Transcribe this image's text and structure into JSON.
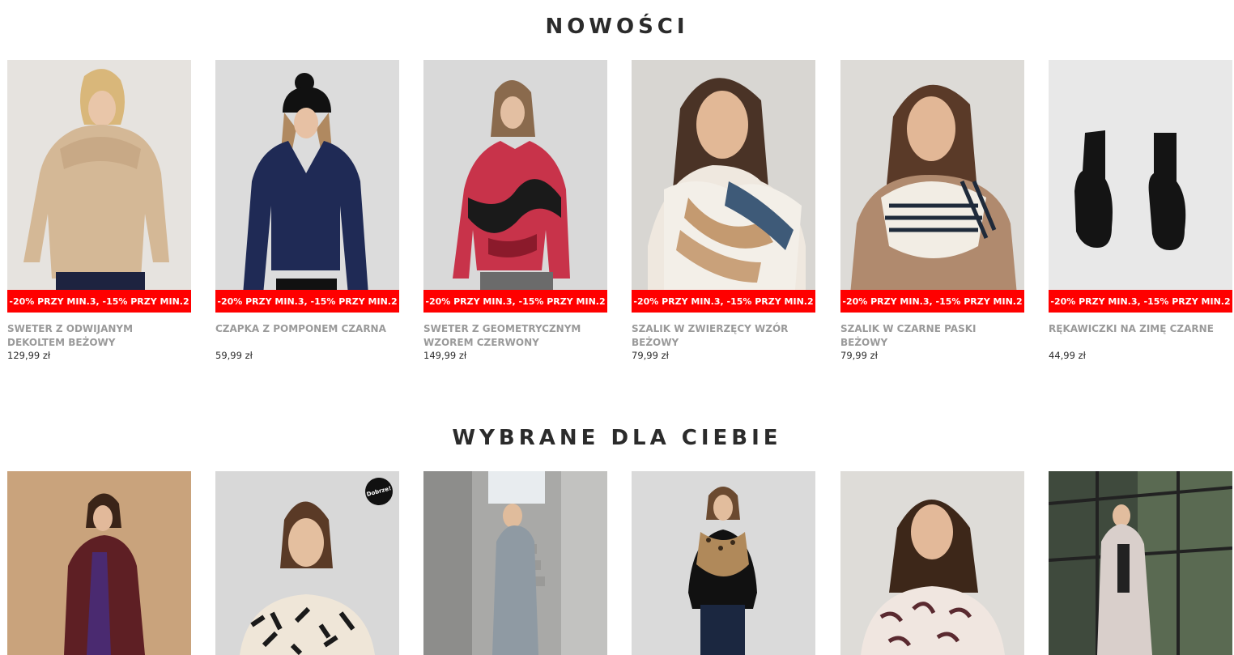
{
  "sections": {
    "new": {
      "title": "NOWOŚCI",
      "products": [
        {
          "name": "SWETER Z ODWIJANYM DEKOLTEM BEŻOWY",
          "price": "129,99 zł",
          "promo": "-20% PRZY MIN.3, -15% PRZY MIN.2",
          "image": "woman-beige-sweater"
        },
        {
          "name": "CZAPKA Z POMPONEM CZARNA",
          "price": "59,99 zł",
          "promo": "-20% PRZY MIN.3, -15% PRZY MIN.2",
          "image": "woman-navy-sweater-black-beanie"
        },
        {
          "name": "SWETER Z GEOMETRYCZNYM WZOREM CZERWONY",
          "price": "149,99 zł",
          "promo": "-20% PRZY MIN.3, -15% PRZY MIN.2",
          "image": "woman-red-black-pattern-sweater"
        },
        {
          "name": "SZALIK W ZWIERZĘCY WZÓR BEŻOWY",
          "price": "79,99 zł",
          "promo": "-20% PRZY MIN.3, -15% PRZY MIN.2",
          "image": "woman-striped-scarf"
        },
        {
          "name": "SZALIK W CZARNE PASKI BEŻOWY",
          "price": "79,99 zł",
          "promo": "-20% PRZY MIN.3, -15% PRZY MIN.2",
          "image": "woman-black-stripe-scarf"
        },
        {
          "name": "RĘKAWICZKI NA ZIMĘ CZARNE",
          "price": "44,99 zł",
          "promo": "-20% PRZY MIN.3, -15% PRZY MIN.2",
          "image": "black-gloves"
        }
      ]
    },
    "picked": {
      "title": "WYBRANE DLA CIEBIE",
      "products": [
        {
          "image": "woman-burgundy-blazer"
        },
        {
          "image": "woman-patterned-blouse",
          "badge": "Dobrze!"
        },
        {
          "image": "woman-grey-coat-stairs"
        },
        {
          "image": "woman-leopard-scarf"
        },
        {
          "image": "woman-paisley-blouse"
        },
        {
          "image": "woman-beige-suit"
        }
      ]
    }
  },
  "colors": {
    "promo_bg": "#ff0000",
    "product_name": "#9a9a9a",
    "price": "#2b2b2b",
    "title": "#2b2b2b"
  }
}
